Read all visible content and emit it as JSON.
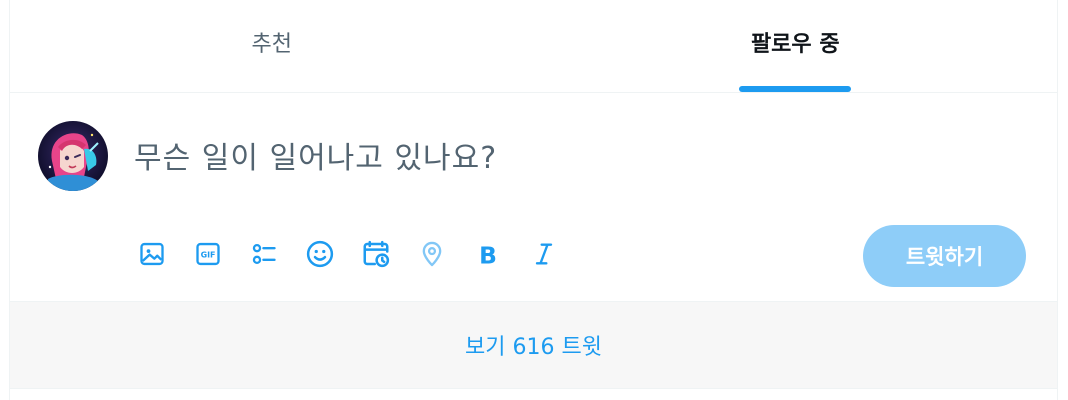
{
  "tabs": [
    {
      "label": "추천",
      "active": false
    },
    {
      "label": "팔로우 중",
      "active": true
    }
  ],
  "composer": {
    "prompt": "무슨 일이 일어나고 있나요?",
    "tweet_button_label": "트윗하기",
    "toolbar_icons": [
      "image-icon",
      "gif-icon",
      "poll-icon",
      "emoji-icon",
      "schedule-icon",
      "location-icon",
      "bold-icon",
      "italic-icon"
    ]
  },
  "show_more": {
    "label": "보기 616 트윗"
  },
  "colors": {
    "accent": "#1d9bf0",
    "button_disabled": "#8ecdf8",
    "muted_text": "#536471",
    "bar_bg": "#f7f7f7"
  }
}
